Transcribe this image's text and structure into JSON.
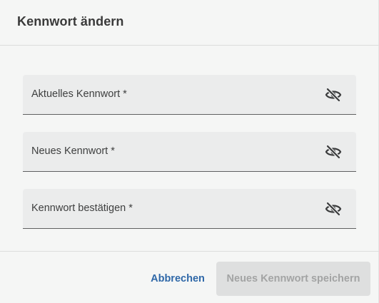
{
  "dialog": {
    "title": "Kennwort ändern"
  },
  "fields": [
    {
      "label": "Aktuelles Kennwort *",
      "icon": "eye-off-icon"
    },
    {
      "label": "Neues Kennwort *",
      "icon": "eye-off-icon"
    },
    {
      "label": "Kennwort bestätigen *",
      "icon": "eye-off-icon"
    }
  ],
  "actions": {
    "cancel_label": "Abbrechen",
    "save_label": "Neues Kennwort speichern",
    "save_disabled": true
  },
  "colors": {
    "background": "#f5f6f5",
    "field_background": "#ebecec",
    "link_blue": "#2f68a8",
    "disabled_button": "#dedfdf",
    "disabled_text": "#a3a4a4"
  }
}
